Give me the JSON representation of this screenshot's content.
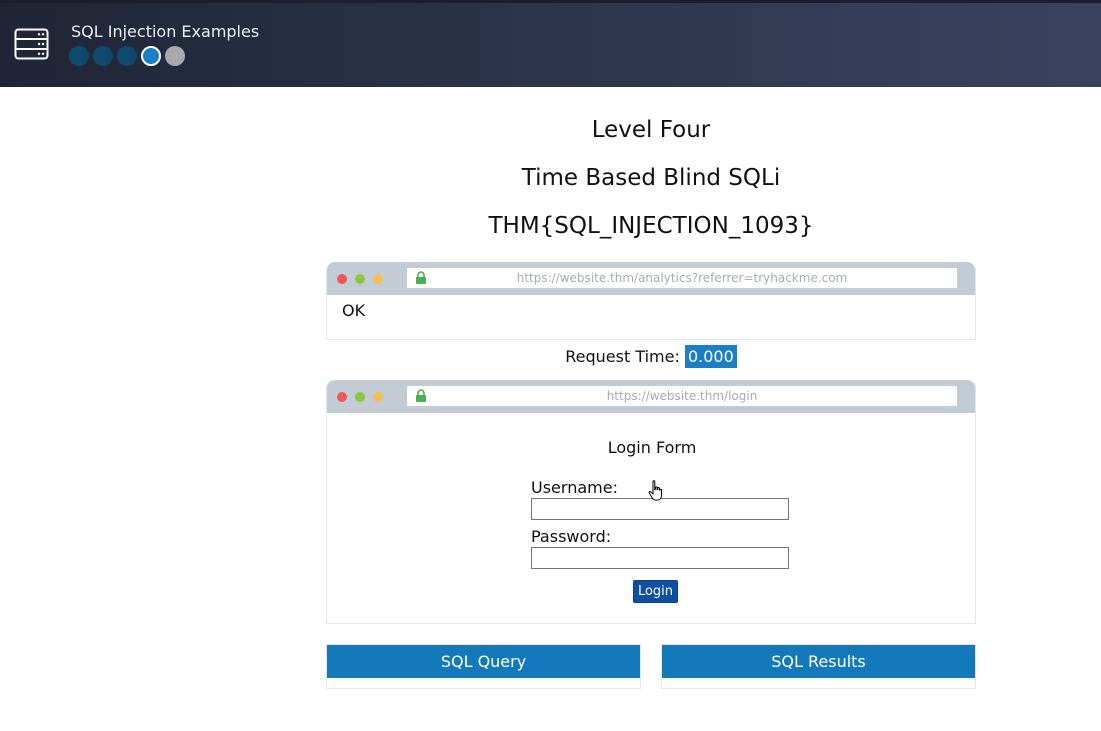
{
  "app": {
    "title": "SQL Injection Examples",
    "progress_total": 5,
    "progress_current": 4
  },
  "headings": {
    "level": "Level Four",
    "subtitle": "Time Based Blind SQLi",
    "flag": "THM{SQL_INJECTION_1093}"
  },
  "analytics_browser": {
    "url": "https://website.thm/analytics?referrer=tryhackme.com",
    "response": "OK"
  },
  "request_time": {
    "label": "Request Time:",
    "value": "0.000"
  },
  "login_browser": {
    "url": "https://website.thm/login",
    "form_title": "Login Form",
    "username_label": "Username:",
    "username_value": "",
    "password_label": "Password:",
    "password_value": "",
    "login_button": "Login"
  },
  "panels": {
    "query_title": "SQL Query",
    "results_title": "SQL Results"
  },
  "colors": {
    "header_bg": "#2f3750",
    "accent": "#1479bb",
    "button": "#0e4fa2"
  },
  "icons": [
    "server-icon",
    "lock-icon",
    "hand-cursor-icon"
  ]
}
